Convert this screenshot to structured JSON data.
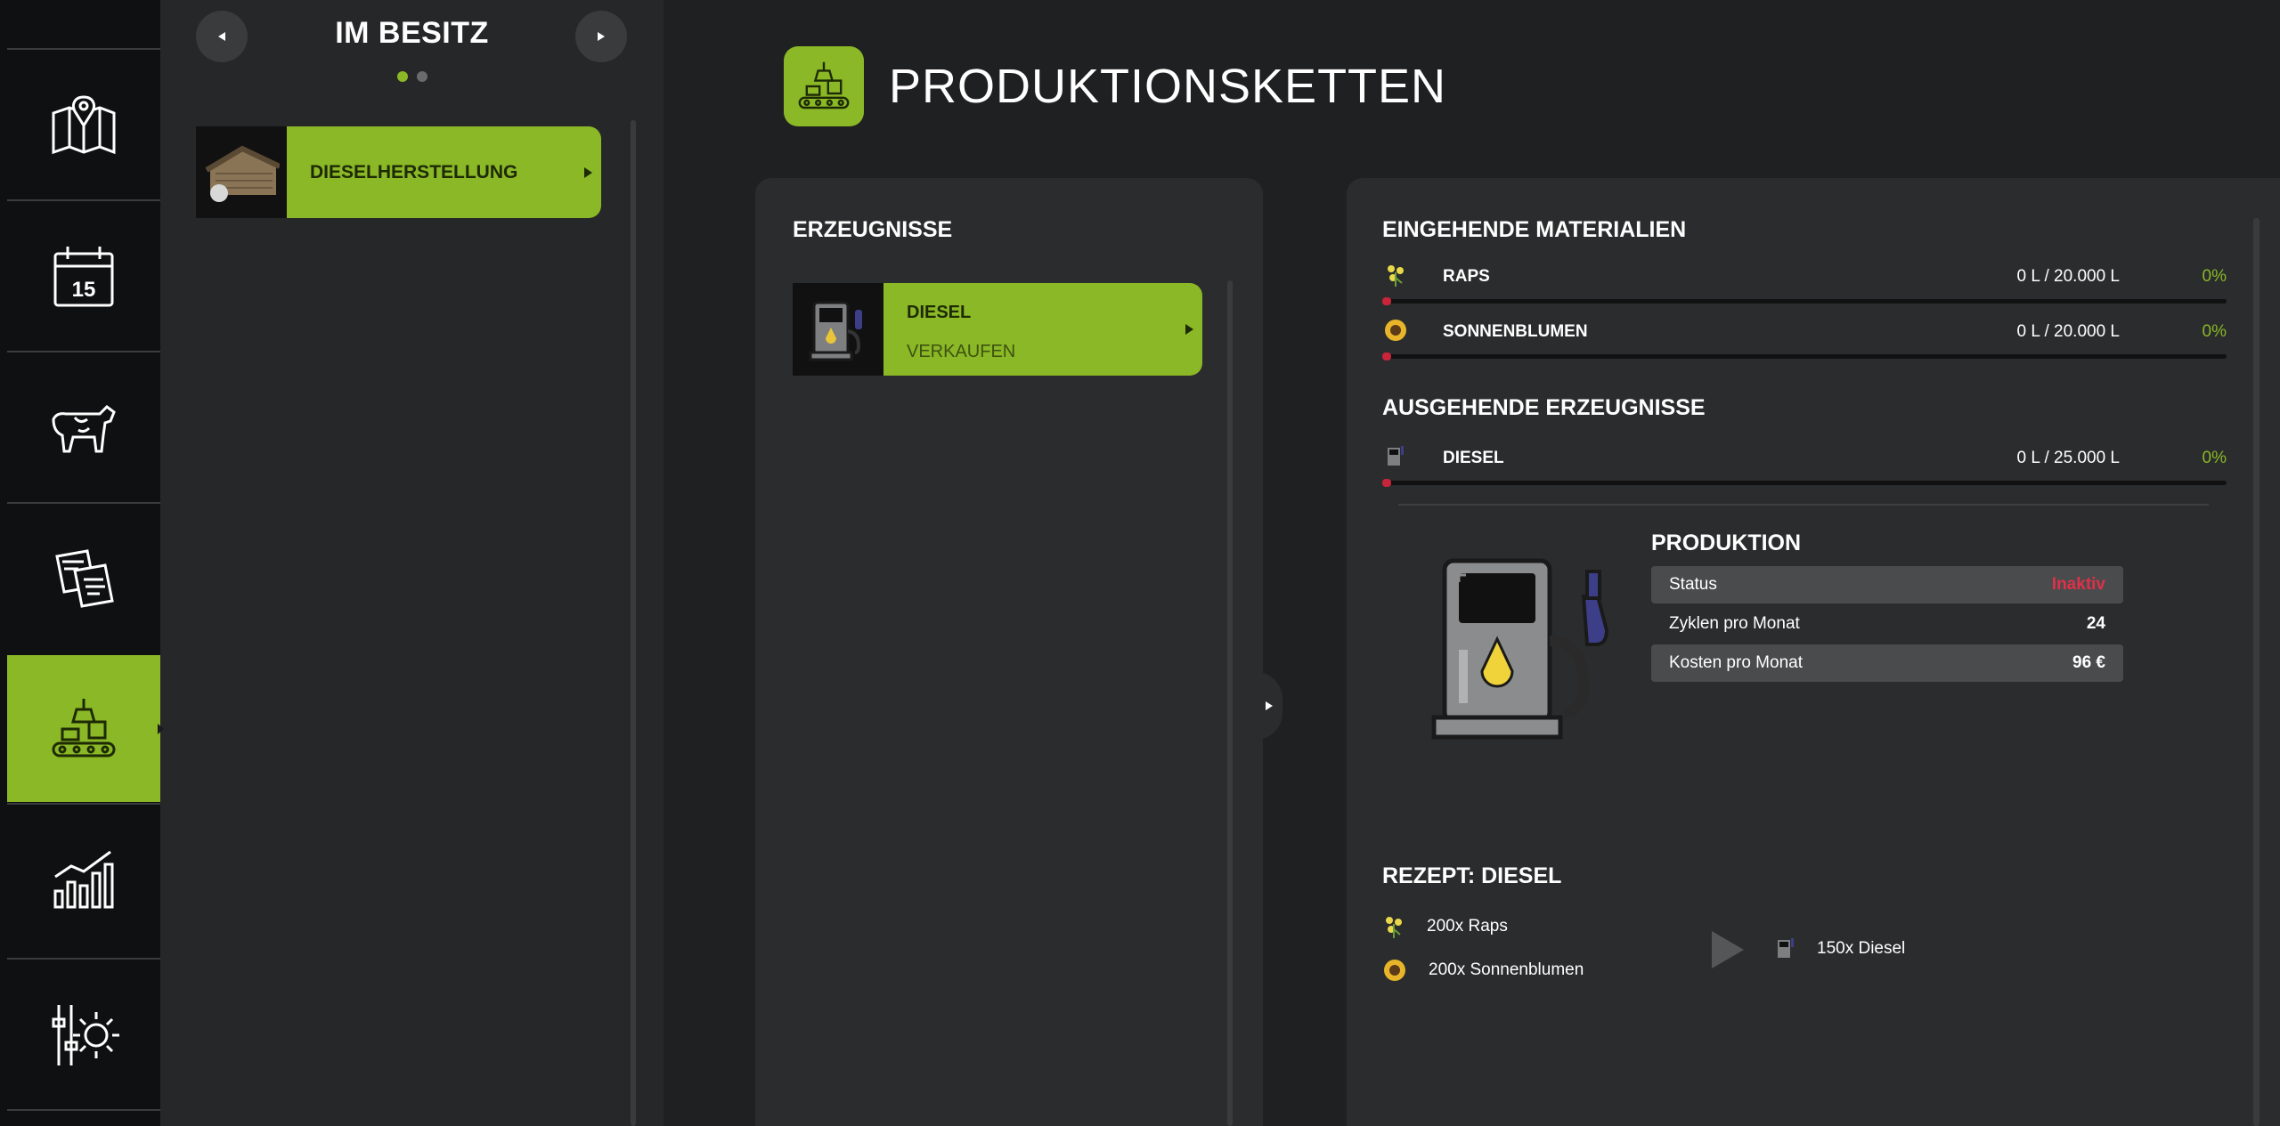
{
  "nav": {
    "items": [
      {
        "name": "map-icon"
      },
      {
        "name": "calendar-icon",
        "badge": "15"
      },
      {
        "name": "animals-icon"
      },
      {
        "name": "contracts-icon"
      },
      {
        "name": "production-icon",
        "active": true
      },
      {
        "name": "statistics-icon"
      },
      {
        "name": "settings-icon"
      }
    ]
  },
  "owned": {
    "title": "IM BESITZ",
    "items": [
      {
        "label": "DIESELHERSTELLUNG"
      }
    ]
  },
  "main": {
    "title": "PRODUKTIONSKETTEN"
  },
  "products": {
    "heading": "ERZEUGNISSE",
    "items": [
      {
        "name": "DIESEL",
        "action": "VERKAUFEN"
      }
    ]
  },
  "details": {
    "incoming_heading": "EINGEHENDE MATERIALIEN",
    "incoming": [
      {
        "name": "RAPS",
        "amount": "0 L / 20.000 L",
        "percent": "0%",
        "icon": "canola-icon",
        "fill_fraction": 0
      },
      {
        "name": "SONNENBLUMEN",
        "amount": "0 L / 20.000 L",
        "percent": "0%",
        "icon": "sunflower-icon",
        "fill_fraction": 0
      }
    ],
    "outgoing_heading": "AUSGEHENDE ERZEUGNISSE",
    "outgoing": [
      {
        "name": "DIESEL",
        "amount": "0 L / 25.000 L",
        "percent": "0%",
        "icon": "diesel-icon",
        "fill_fraction": 0
      }
    ],
    "production": {
      "heading": "PRODUKTION",
      "rows": [
        {
          "label": "Status",
          "value": "Inaktiv"
        },
        {
          "label": "Zyklen pro Monat",
          "value": "24"
        },
        {
          "label": "Kosten pro Monat",
          "value": "96 €"
        }
      ]
    },
    "recipe": {
      "heading": "REZEPT: DIESEL",
      "inputs": [
        {
          "text": "200x Raps",
          "icon": "canola-icon"
        },
        {
          "text": "200x Sonnenblumen",
          "icon": "sunflower-icon"
        }
      ],
      "output": {
        "text": "150x Diesel",
        "icon": "diesel-icon"
      }
    }
  },
  "colors": {
    "accent": "#8ab826",
    "status_inactive": "#e0304a",
    "background": "#1f2021"
  }
}
